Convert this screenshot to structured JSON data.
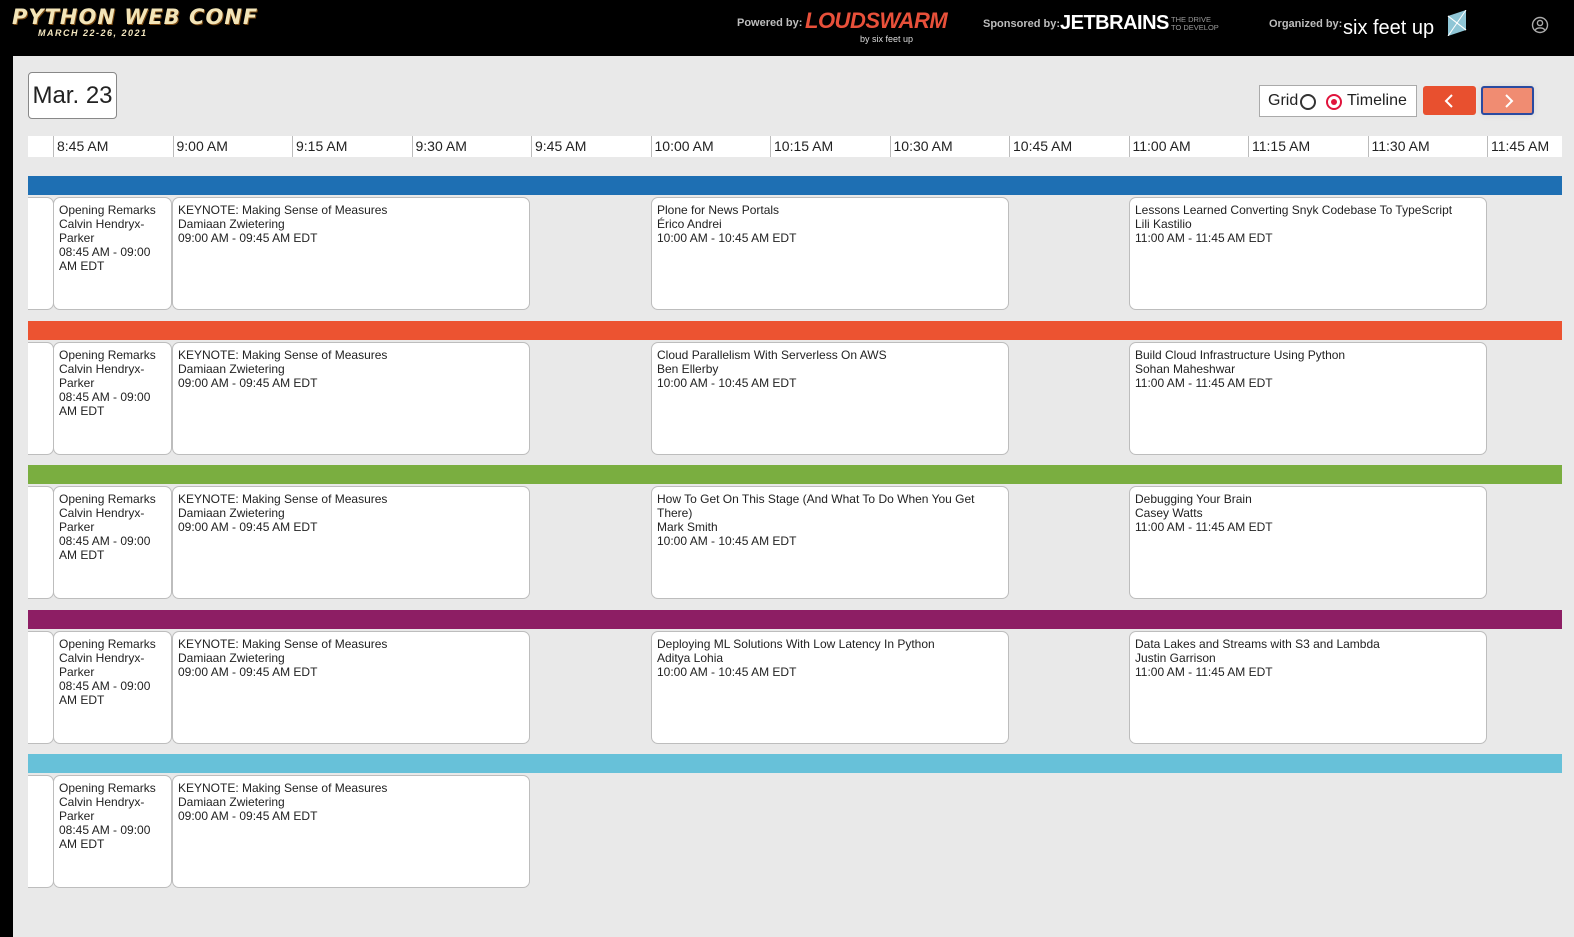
{
  "header": {
    "logo_title": "PYTHON WEB CONF",
    "logo_dates": "MARCH 22-26, 2021",
    "powered_label": "Powered by:",
    "powered_name": "LOUDSWARM",
    "powered_by": "by six feet up",
    "sponsored_label": "Sponsored by:",
    "sponsored_name": "JETBRAINS",
    "sponsored_tag_1": "THE DRIVE",
    "sponsored_tag_2": "TO DEVELOP",
    "organized_label": "Organized by:",
    "organized_name": "six feet up"
  },
  "toolbar": {
    "date": "Mar. 23",
    "view_grid": "Grid",
    "view_timeline": "Timeline",
    "selected_view": "Timeline"
  },
  "times": [
    "8:45 AM",
    "9:00 AM",
    "9:15 AM",
    "9:30 AM",
    "9:45 AM",
    "10:00 AM",
    "10:15 AM",
    "10:30 AM",
    "10:45 AM",
    "11:00 AM",
    "11:15 AM",
    "11:30 AM",
    "11:45 AM"
  ],
  "tracks": [
    {
      "color": "#1e6fb3",
      "sessions": [
        {
          "title": "Opening Remarks",
          "speaker": "Calvin Hendryx-Parker",
          "time": "08:45 AM - 09:00 AM EDT"
        },
        {
          "title": "KEYNOTE: Making Sense of Measures",
          "speaker": "Damiaan Zwietering",
          "time": "09:00 AM - 09:45 AM EDT"
        },
        {
          "title": "Plone for News Portals",
          "speaker": "Érico Andrei",
          "time": "10:00 AM - 10:45 AM EDT"
        },
        {
          "title": "Lessons Learned Converting Snyk Codebase To TypeScript",
          "speaker": "Lili Kastilio",
          "time": "11:00 AM - 11:45 AM EDT"
        }
      ]
    },
    {
      "color": "#ec5331",
      "sessions": [
        {
          "title": "Opening Remarks",
          "speaker": "Calvin Hendryx-Parker",
          "time": "08:45 AM - 09:00 AM EDT"
        },
        {
          "title": "KEYNOTE: Making Sense of Measures",
          "speaker": "Damiaan Zwietering",
          "time": "09:00 AM - 09:45 AM EDT"
        },
        {
          "title": "Cloud Parallelism With Serverless On AWS",
          "speaker": "Ben Ellerby",
          "time": "10:00 AM - 10:45 AM EDT"
        },
        {
          "title": "Build Cloud Infrastructure Using Python",
          "speaker": "Sohan Maheshwar",
          "time": "11:00 AM - 11:45 AM EDT"
        }
      ]
    },
    {
      "color": "#7aae40",
      "sessions": [
        {
          "title": "Opening Remarks",
          "speaker": "Calvin Hendryx-Parker",
          "time": "08:45 AM - 09:00 AM EDT"
        },
        {
          "title": "KEYNOTE: Making Sense of Measures",
          "speaker": "Damiaan Zwietering",
          "time": "09:00 AM - 09:45 AM EDT"
        },
        {
          "title": "How To Get On This Stage (And What To Do When You Get There)",
          "speaker": "Mark Smith",
          "time": "10:00 AM - 10:45 AM EDT"
        },
        {
          "title": "Debugging Your Brain",
          "speaker": "Casey Watts",
          "time": "11:00 AM - 11:45 AM EDT"
        }
      ]
    },
    {
      "color": "#8d1e64",
      "sessions": [
        {
          "title": "Opening Remarks",
          "speaker": "Calvin Hendryx-Parker",
          "time": "08:45 AM - 09:00 AM EDT"
        },
        {
          "title": "KEYNOTE: Making Sense of Measures",
          "speaker": "Damiaan Zwietering",
          "time": "09:00 AM - 09:45 AM EDT"
        },
        {
          "title": "Deploying ML Solutions With Low Latency In Python",
          "speaker": "Aditya Lohia",
          "time": "10:00 AM - 10:45 AM EDT"
        },
        {
          "title": "Data Lakes and Streams with S3 and Lambda",
          "speaker": "Justin Garrison",
          "time": "11:00 AM - 11:45 AM EDT"
        }
      ]
    },
    {
      "color": "#67c1d9",
      "sessions": [
        {
          "title": "Opening Remarks",
          "speaker": "Calvin Hendryx-Parker",
          "time": "08:45 AM - 09:00 AM EDT"
        },
        {
          "title": "KEYNOTE: Making Sense of Measures",
          "speaker": "Damiaan Zwietering",
          "time": "09:00 AM - 09:45 AM EDT"
        }
      ]
    }
  ]
}
